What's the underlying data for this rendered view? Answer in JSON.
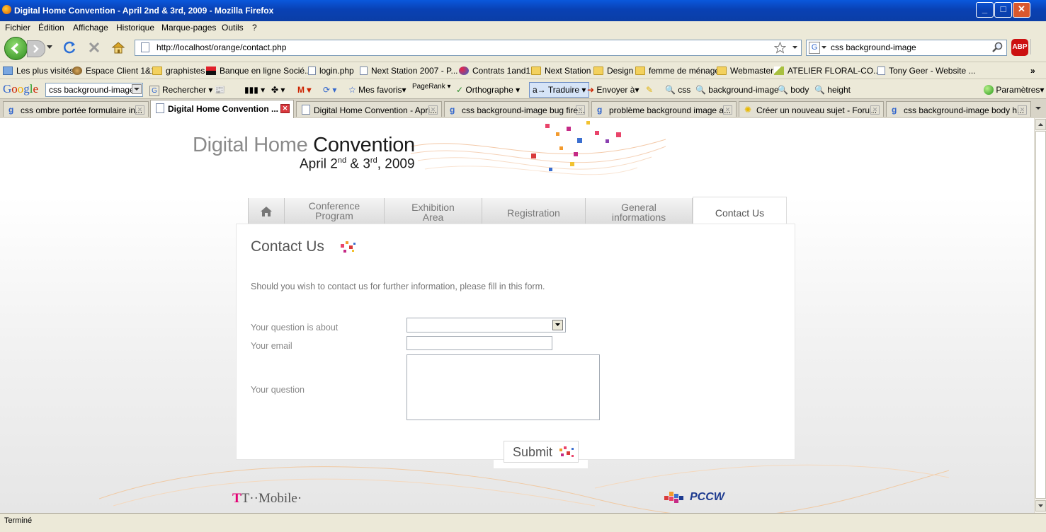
{
  "window": {
    "title": "Digital Home Convention - April 2nd & 3rd, 2009 - Mozilla Firefox",
    "min": "_",
    "max": "□",
    "close": "✕"
  },
  "menu": [
    "Fichier",
    "Édition",
    "Affichage",
    "Historique",
    "Marque-pages",
    "Outils",
    "?"
  ],
  "nav": {
    "url": "http://localhost/orange/contact.php",
    "search_value": "css background-image",
    "adblock": "ABP"
  },
  "bookmarks": [
    "Les plus visités",
    "Espace Client 1&1",
    "graphistes",
    "Banque en ligne Socié...",
    "login.php",
    "Next Station 2007 - P...",
    "Contrats 1and1",
    "Next Station",
    "Design",
    "femme de ménage",
    "Webmaster",
    "ATELIER FLORAL-CO...",
    "Tony Geer - Website ...",
    "»"
  ],
  "google_toolbar": {
    "logo": "Google",
    "search_value": "css background-image",
    "rechercher": "Rechercher",
    "mes_favoris": "Mes favoris",
    "pagerank": "PageRank",
    "orthographe": "Orthographe",
    "traduire": "Traduire",
    "envoyer": "Envoyer à",
    "css": "css",
    "background_image": "background-image",
    "body": "body",
    "height": "height",
    "parametres": "Paramètres"
  },
  "tabs": [
    "css ombre portée formulaire in...",
    "Digital Home Convention ...",
    "Digital Home Convention - Apri...",
    "css background-image bug fire...",
    "problème background image a...",
    "Créer un nouveau sujet - Foru...",
    "css background-image body h..."
  ],
  "site": {
    "brand_light": "Digital Home",
    "brand_bold": "Convention",
    "date_prefix": "April 2",
    "date_sup1": "nd",
    "date_mid": " & 3",
    "date_sup2": "rd",
    "date_suffix": ", 2009",
    "nav": [
      {
        "l1": "Conference",
        "l2": "Program"
      },
      {
        "l1": "Exhibition",
        "l2": "Area"
      },
      {
        "l1": "Registration",
        "l2": ""
      },
      {
        "l1": "General",
        "l2": "informations"
      },
      {
        "l1": "Contact Us",
        "l2": ""
      }
    ],
    "page_title": "Contact Us",
    "intro": "Should you wish to contact us for further information, please fill in this form.",
    "label_about": "Your question is about",
    "label_email": "Your email",
    "label_question": "Your question",
    "submit": "Submit",
    "sponsor1": "T··Mobile·",
    "sponsor2": "PCCW"
  },
  "status": "Terminé",
  "colors": {
    "tmobile": "#e20074",
    "pccw": "#1d3a8f",
    "title_bar": "#0a58dc"
  }
}
